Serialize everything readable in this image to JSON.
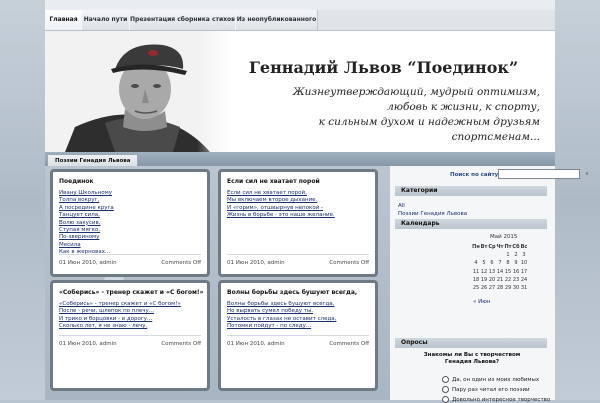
{
  "nav": {
    "items": [
      {
        "label": "Главная",
        "active": true
      },
      {
        "label": "Начало пути",
        "active": false
      },
      {
        "label": "Презентация сборника стихов",
        "active": false
      },
      {
        "label": "Из неопубликованного",
        "active": false
      }
    ]
  },
  "header": {
    "title": "Геннадий Львов “Поединок”",
    "motto": [
      "Жизнеутверждающий, мудрый оптимизм,",
      "любовь к жизни, к спорту,",
      "к сильным духом и надежным друзьям",
      "спортсменам..."
    ]
  },
  "subbar": {
    "tab": "Поэзии Генадия Львова"
  },
  "posts": [
    {
      "title": "Поединок",
      "lines": [
        "Ивану Школьному",
        "Толпа вокруг,",
        "А посредине круга",
        "Танцует сила,",
        "Волю закусив,",
        "Ступая мягко,",
        "По-звериному",
        "Месила",
        "Как в жерновах..."
      ],
      "date": "01 Июн 2010, admin",
      "comments": "Comments Off"
    },
    {
      "title": "Если сил не хватает порой",
      "lines": [
        "Если сил не хватает порой,",
        "Мы включаем второе дыхание.",
        "И «горим», отшвырнув непокой -",
        "Жизнь в борьбе - это наше желание."
      ],
      "date": "01 Июн 2010, admin",
      "comments": "Comments Off"
    },
    {
      "title": "«Соберись» - тренер скажет и «С богом!»",
      "lines": [
        "«Соберись» - тренер скажет и «С богом!»",
        "После - речи, шлепок по плечу...",
        "И трико и борцовки - в дорогу...",
        "Сколько лет, я не знаю - лечу."
      ],
      "date": "01 Июн 2010, admin",
      "comments": "Comments Off"
    },
    {
      "title": "Волны борьбы здесь бушуют всегда,",
      "lines": [
        "Волны борьбы здесь бушуют всегда,",
        "Но вырвать сумел победу ты.",
        "Усталость в глазах не оставит следа,",
        "Потомки пойдут - по следу..."
      ],
      "date": "01 Июн 2010, admin",
      "comments": "Comments Off"
    }
  ],
  "sidebar": {
    "search_label": "Поиск по сайту",
    "search_value": "",
    "search_button": "»",
    "categories_title": "Категории",
    "categories": [
      "All",
      "Поэзии Генадия Львова"
    ],
    "calendar_title": "Календарь",
    "calendar": {
      "caption": "Май 2015",
      "weekdays": [
        "Пн",
        "Вт",
        "Ср",
        "Чт",
        "Пт",
        "Сб",
        "Вс"
      ],
      "weeks": [
        [
          "",
          "",
          "",
          "",
          "1",
          "2",
          "3"
        ],
        [
          "4",
          "5",
          "6",
          "7",
          "8",
          "9",
          "10"
        ],
        [
          "11",
          "12",
          "13",
          "14",
          "15",
          "16",
          "17"
        ],
        [
          "18",
          "19",
          "20",
          "21",
          "22",
          "23",
          "24"
        ],
        [
          "25",
          "26",
          "27",
          "28",
          "29",
          "30",
          "31"
        ]
      ],
      "prev": "« Июн"
    },
    "polls_title": "Опросы",
    "poll_question": "Знакомы ли Вы с творчеством Генадия Львова?",
    "poll_options": [
      "Да, он один из моих любимых",
      "Пару раз читал его поэзии",
      "Довольно интересное творчество"
    ]
  },
  "colors": {
    "background": "#b8c4cf",
    "post_border": "#6e7a86",
    "link": "#1a2f6e"
  }
}
